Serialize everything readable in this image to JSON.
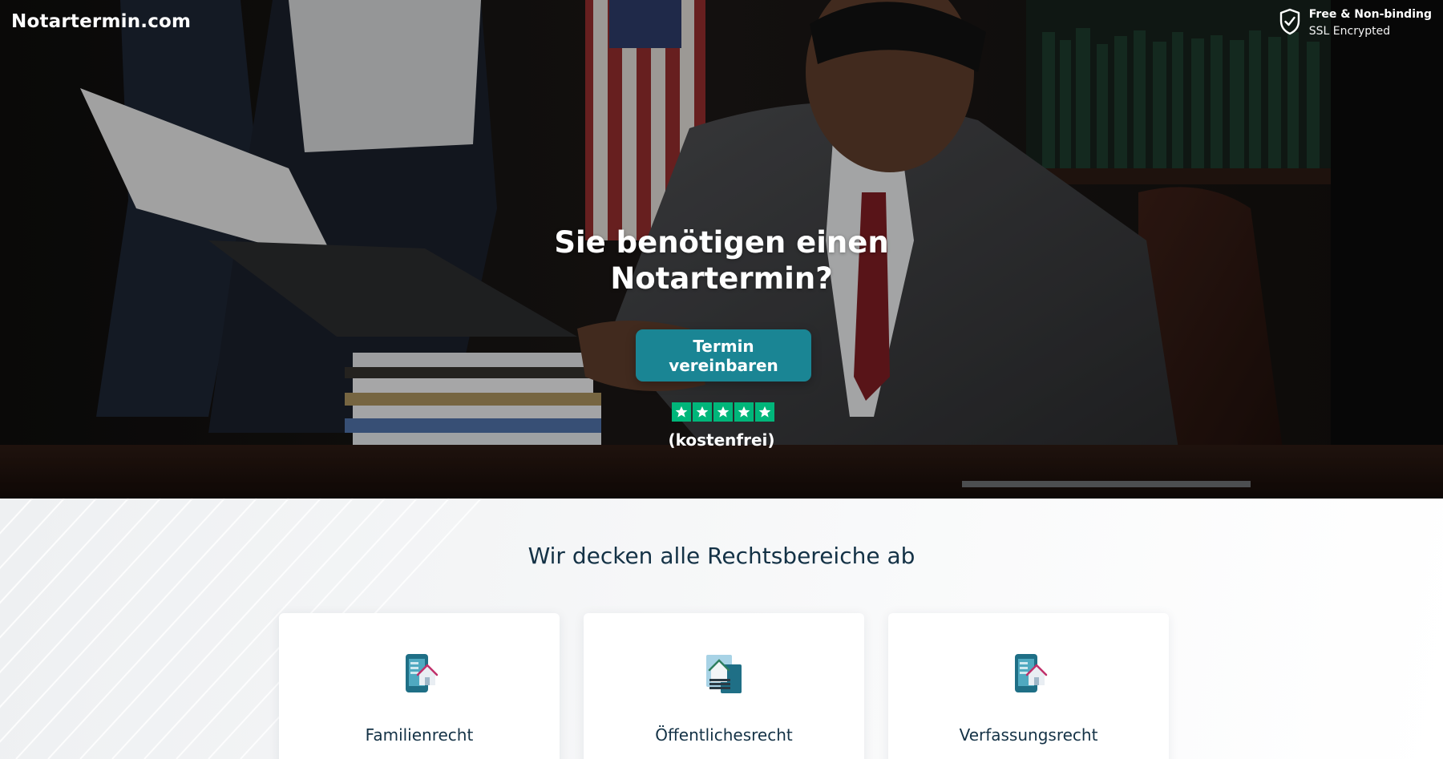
{
  "brand": {
    "name": "Notartermin.com"
  },
  "security": {
    "line1": "Free & Non-binding",
    "line2": "SSL Encrypted",
    "icon": "shield-check-icon"
  },
  "hero": {
    "title_line1": "Sie benötigen einen",
    "title_line2": "Notartermin?",
    "cta_label": "Termin vereinbaren",
    "rating_stars": 5,
    "rating_note": "(kostenfrei)",
    "cta_color": "#1a8594",
    "star_color": "#00b67a"
  },
  "section": {
    "title": "Wir decken alle Rechtsbereiche ab",
    "cards": [
      {
        "label": "Familienrecht",
        "icon": "phone-house-icon"
      },
      {
        "label": "Öffentlichesrecht",
        "icon": "document-house-icon"
      },
      {
        "label": "Verfassungsrecht",
        "icon": "phone-house-icon"
      }
    ]
  }
}
